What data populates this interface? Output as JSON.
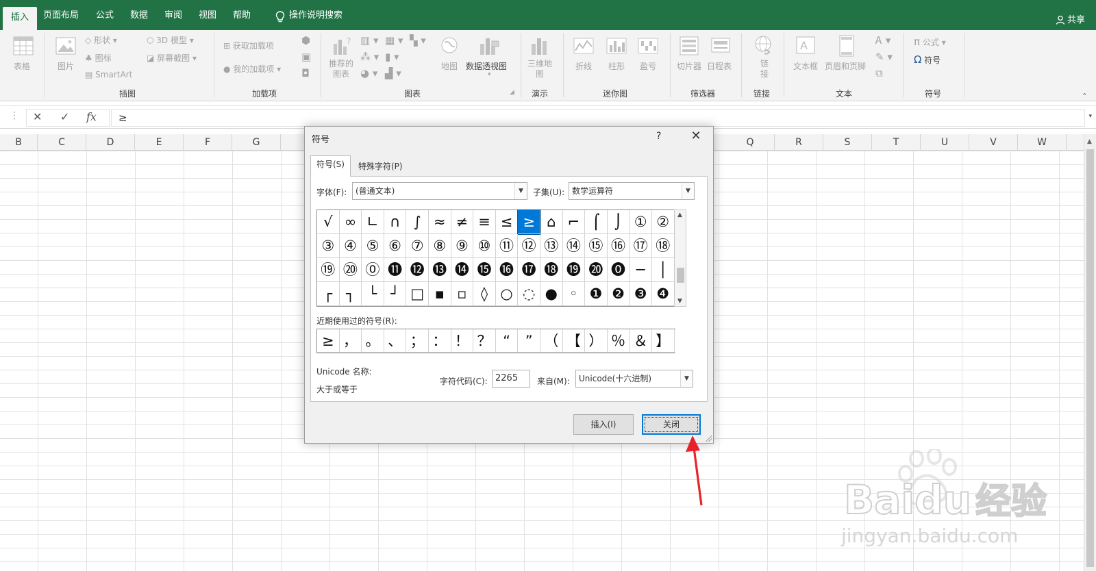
{
  "menu": {
    "tabs": [
      "插入",
      "页面布局",
      "公式",
      "数据",
      "审阅",
      "视图",
      "帮助"
    ],
    "active_tab": "插入",
    "search": "操作说明搜索",
    "share": "共享"
  },
  "ribbon": {
    "table": "表格",
    "picture": "图片",
    "shapes": "形状",
    "icons": "图标",
    "smartart": "SmartArt",
    "model3d": "3D 模型",
    "screenshot": "屏幕截图",
    "get_addins": "获取加载项",
    "my_addins": "我的加载项",
    "recommended_charts": "推荐的\n图表",
    "maps": "地图",
    "pivotchart": "数据透视图",
    "map3d": "三维地\n图",
    "line": "折线",
    "column": "柱形",
    "winloss": "盈亏",
    "slicer": "切片器",
    "timeline": "日程表",
    "link": "链\n接",
    "textbox": "文本框",
    "header_footer": "页眉和页脚",
    "equation": "公式",
    "symbol": "符号",
    "groups": {
      "illustrations": "插图",
      "addins": "加载项",
      "charts": "图表",
      "tours": "演示",
      "sparklines": "迷你图",
      "filters": "筛选器",
      "links": "链接",
      "text": "文本",
      "symbols": "符号"
    }
  },
  "formula_bar": {
    "cancel": "✕",
    "enter": "✓",
    "fx": "fx",
    "value": "≥"
  },
  "columns": [
    "B",
    "C",
    "D",
    "E",
    "F",
    "G",
    "Q",
    "R",
    "S",
    "T",
    "U",
    "V",
    "W"
  ],
  "dialog": {
    "title": "符号",
    "help": "?",
    "close_x": "✕",
    "tabs": [
      "符号(S)",
      "特殊字符(P)"
    ],
    "font_label": "字体(F):",
    "font_value": "(普通文本)",
    "subset_label": "子集(U):",
    "subset_value": "数学运算符",
    "symbols": [
      [
        "√",
        "∞",
        "∟",
        "∩",
        "∫",
        "≈",
        "≠",
        "≡",
        "≤",
        "≥",
        "⌂",
        "⌐",
        "⌠",
        "⌡",
        "①",
        "②"
      ],
      [
        "③",
        "④",
        "⑤",
        "⑥",
        "⑦",
        "⑧",
        "⑨",
        "⑩",
        "⑪",
        "⑫",
        "⑬",
        "⑭",
        "⑮",
        "⑯",
        "⑰",
        "⑱"
      ],
      [
        "⑲",
        "⑳",
        "⓪",
        "⓫",
        "⓬",
        "⓭",
        "⓮",
        "⓯",
        "⓰",
        "⓱",
        "⓲",
        "⓳",
        "⓴",
        "⓿",
        "─",
        "│"
      ],
      [
        "┌",
        "┐",
        "└",
        "┘",
        "□",
        "▪",
        "▫",
        "◊",
        "○",
        "◌",
        "●",
        "◦",
        "❶",
        "❷",
        "❸",
        "❹"
      ]
    ],
    "selected_symbol": "≥",
    "recent_label": "近期使用过的符号(R):",
    "recent": [
      "≥",
      "，",
      "。",
      "、",
      "；",
      "：",
      "！",
      "？",
      "“",
      "”",
      "（",
      "【",
      "）",
      "％",
      "＆",
      "】"
    ],
    "unicode_name_label": "Unicode 名称:",
    "unicode_name": "大于或等于",
    "char_code_label": "字符代码(C):",
    "char_code": "2265",
    "from_label": "来自(M):",
    "from_value": "Unicode(十六进制)",
    "insert_button": "插入(I)",
    "close_button": "关闭"
  },
  "watermark": {
    "brand": "Bai",
    "brand2": "du",
    "brand_cn": "经验",
    "url": "jingyan.baidu.com"
  },
  "colors": {
    "excel_green": "#217346",
    "selection_blue": "#0078d7",
    "annotation_red": "#e8222a"
  }
}
